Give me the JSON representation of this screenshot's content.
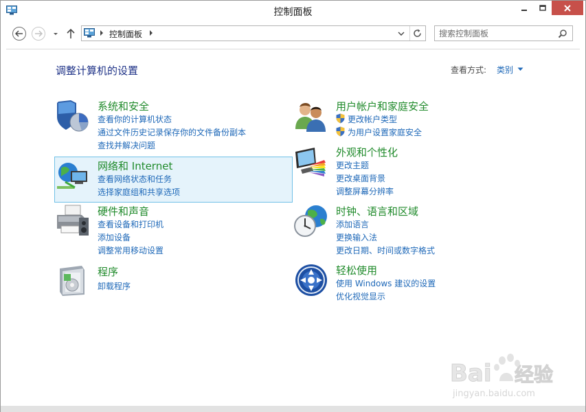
{
  "window": {
    "title": "控制面板",
    "icon": "control-panel-icon"
  },
  "nav": {
    "breadcrumb": "控制面板",
    "search_placeholder": "搜索控制面板"
  },
  "content": {
    "page_title": "调整计算机的设置",
    "view_by_label": "查看方式:",
    "view_by_value": "类别"
  },
  "categories": [
    {
      "title": "系统和安全",
      "icon": "shield-security-icon",
      "links": [
        "查看你的计算机状态",
        "通过文件历史记录保存你的文件备份副本",
        "查找并解决问题"
      ]
    },
    {
      "title": "网络和 Internet",
      "icon": "network-globe-icon",
      "links": [
        "查看网络状态和任务",
        "选择家庭组和共享选项"
      ]
    },
    {
      "title": "硬件和声音",
      "icon": "printer-hardware-icon",
      "links": [
        "查看设备和打印机",
        "添加设备",
        "调整常用移动设置"
      ]
    },
    {
      "title": "程序",
      "icon": "programs-box-icon",
      "links": [
        "卸载程序"
      ]
    },
    {
      "title": "用户帐户和家庭安全",
      "icon": "users-icon",
      "links": [
        "更改帐户类型",
        "为用户设置家庭安全"
      ]
    },
    {
      "title": "外观和个性化",
      "icon": "monitor-palette-icon",
      "links": [
        "更改主题",
        "更改桌面背景",
        "调整屏幕分辨率"
      ]
    },
    {
      "title": "时钟、语言和区域",
      "icon": "clock-globe-icon",
      "links": [
        "添加语言",
        "更换输入法",
        "更改日期、时间或数字格式"
      ]
    },
    {
      "title": "轻松使用",
      "icon": "ease-of-access-icon",
      "links": [
        "使用 Windows 建议的设置",
        "优化视觉显示"
      ]
    }
  ],
  "watermark": {
    "brand": "Baidu经验",
    "url": "jingyan.baidu.com"
  },
  "colors": {
    "link": "#1e68b8",
    "category_title": "#1f8a2a",
    "page_title": "#1e3287",
    "close_button": "#c7504a",
    "highlight_bg": "#e5f3fb",
    "highlight_border": "#70c0e7"
  }
}
